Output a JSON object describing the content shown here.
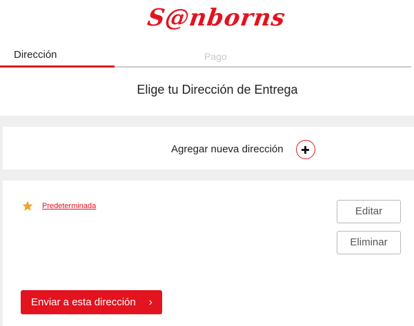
{
  "brand": {
    "logo_text": "S@nborns",
    "accent": "#e3131f"
  },
  "tabs": [
    {
      "label": "Dirección",
      "active": true
    },
    {
      "label": "Pago",
      "active": false
    }
  ],
  "page": {
    "title": "Elige tu Dirección de Entrega"
  },
  "add_address": {
    "label": "Agregar nueva dirección",
    "icon": "plus-circle-icon"
  },
  "address_card": {
    "default_label": "Predeterminada",
    "star_icon": "star-icon",
    "edit_label": "Editar",
    "delete_label": "Eliminar",
    "send_label": "Enviar a esta dirección",
    "send_icon": "chevron-right-icon"
  }
}
